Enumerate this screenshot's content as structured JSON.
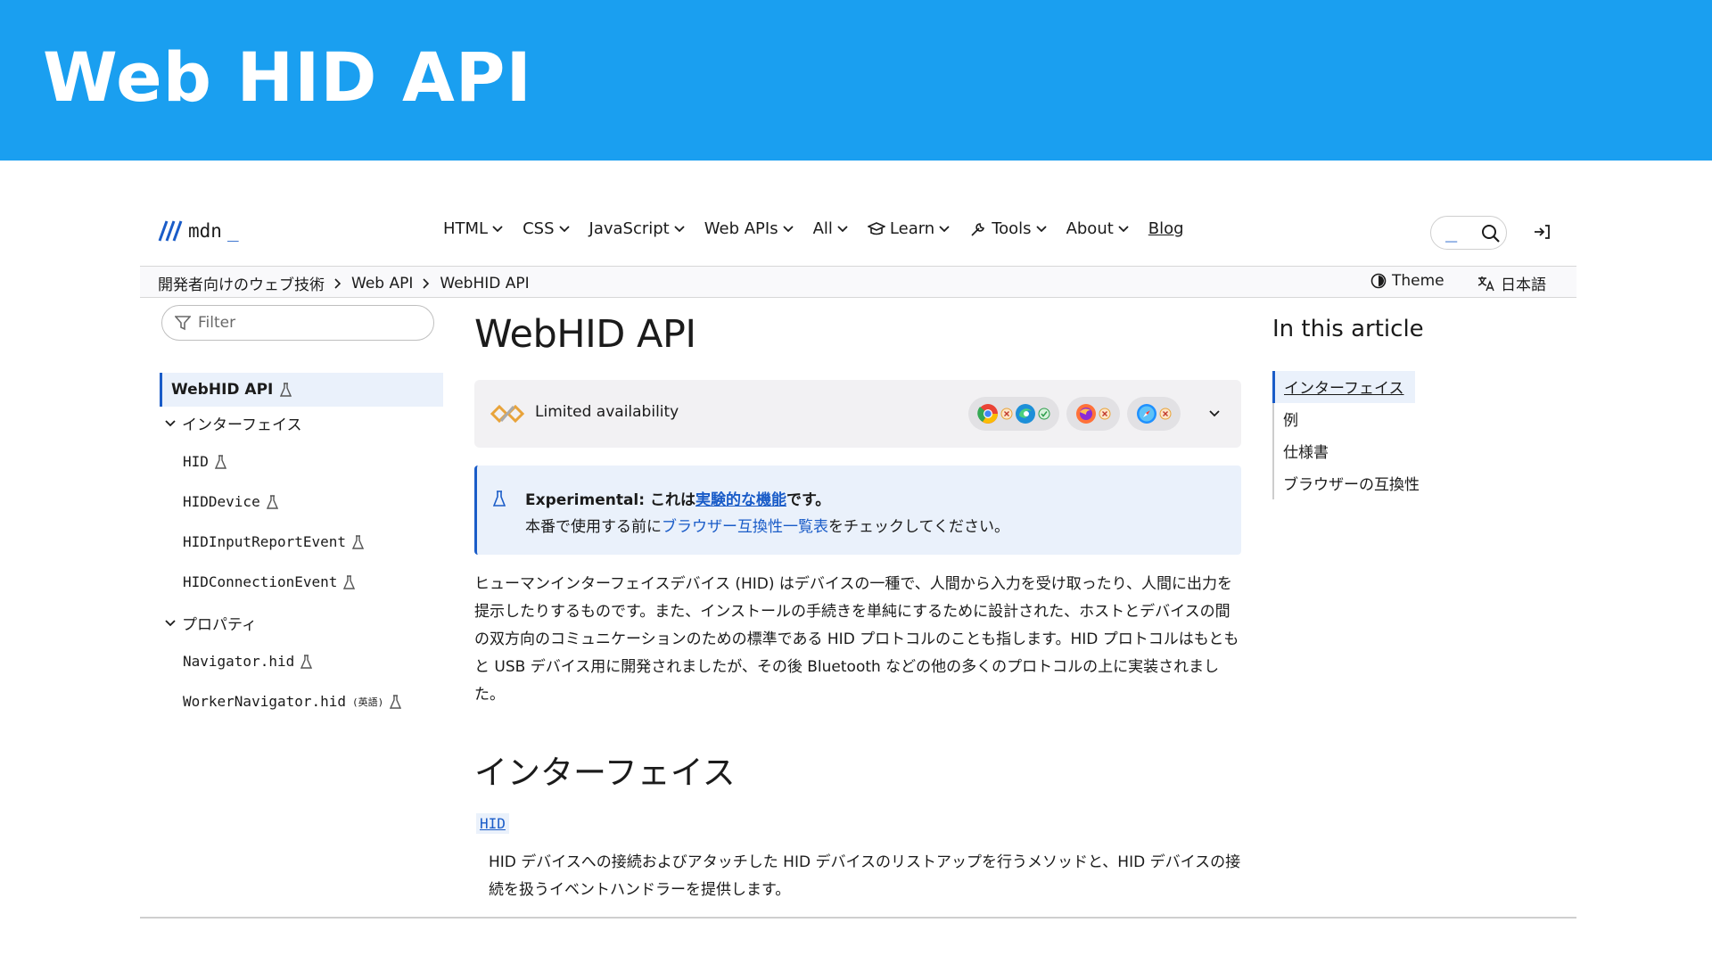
{
  "slide": {
    "title": "Web HID API"
  },
  "nav": {
    "logo_text": "mdn",
    "logo_cursor": "_",
    "menu": [
      {
        "label": "HTML"
      },
      {
        "label": "CSS"
      },
      {
        "label": "JavaScript"
      },
      {
        "label": "Web APIs"
      },
      {
        "label": "All"
      },
      {
        "label": "Learn"
      },
      {
        "label": "Tools"
      },
      {
        "label": "About"
      },
      {
        "label": "Blog"
      }
    ],
    "search_cursor": "_"
  },
  "breadcrumb": {
    "items": [
      "開発者向けのウェブ技術",
      "Web API",
      "WebHID API"
    ],
    "theme_label": "Theme",
    "lang_label": "日本語"
  },
  "sidebar": {
    "filter_placeholder": "Filter",
    "active": "WebHID API",
    "group_interfaces": "インターフェイス",
    "interfaces": [
      "HID",
      "HIDDevice",
      "HIDInputReportEvent",
      "HIDConnectionEvent"
    ],
    "group_properties": "プロパティ",
    "properties": [
      "Navigator.hid",
      "WorkerNavigator.hid"
    ],
    "english_badge": "(英語)"
  },
  "article": {
    "title": "WebHID API",
    "availability": "Limited availability",
    "experimental_label": "Experimental:",
    "experimental_pre": " これは",
    "experimental_link": "実験的な機能",
    "experimental_post": "です。",
    "exp_line2_pre": "本番で使用する前に",
    "exp_line2_link": "ブラウザー互換性一覧表",
    "exp_line2_post": "をチェックしてください。",
    "intro": "ヒューマンインターフェイスデバイス (HID) はデバイスの一種で、人間から入力を受け取ったり、人間に出力を提示したりするものです。また、インストールの手続きを単純にするために設計された、ホストとデバイスの間の双方向のコミュニケーションのための標準である HID プロトコルのことも指します。HID プロトコルはもともと USB デバイス用に開発されましたが、その後 Bluetooth などの他の多くのプロトコルの上に実装されました。",
    "h2": "インターフェイス",
    "hid_code": "HID",
    "hid_desc": "HID デバイスへの接続およびアタッチした HID デバイスのリストアップを行うメソッドと、HID デバイスの接続を扱うイベントハンドラーを提供します。"
  },
  "toc": {
    "title": "In this article",
    "items": [
      "インターフェイス",
      "例",
      "仕様書",
      "ブラウザーの互換性"
    ]
  },
  "colors": {
    "header_band": "#1a9ff0",
    "accent": "#1a5cc8"
  }
}
